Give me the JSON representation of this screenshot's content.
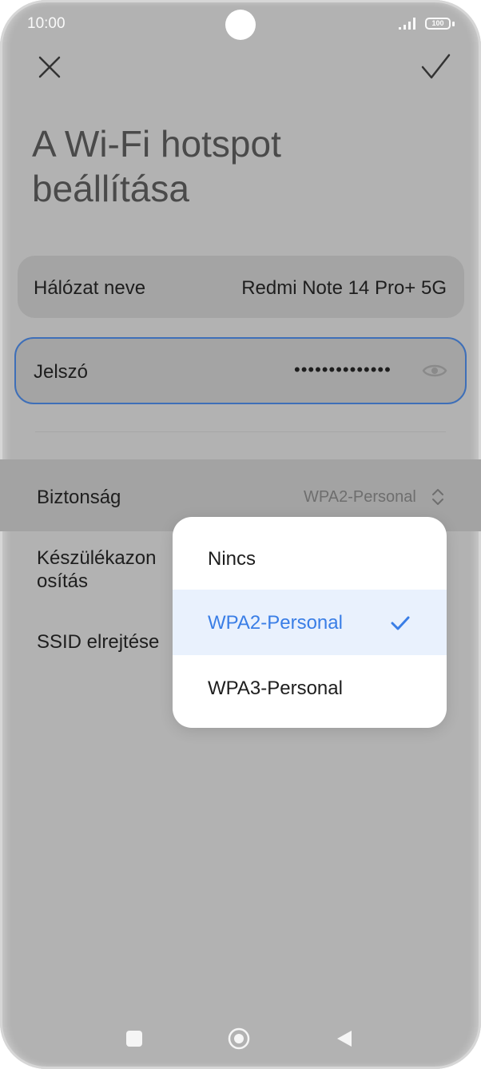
{
  "status_bar": {
    "time": "10:00",
    "battery": "100"
  },
  "header": {
    "title": "A Wi-Fi hotspot beállítása"
  },
  "network_name": {
    "label": "Hálózat neve",
    "value": "Redmi Note 14 Pro+ 5G"
  },
  "password": {
    "label": "Jelszó",
    "value": "••••••••••••••"
  },
  "security": {
    "label": "Biztonság",
    "value": "WPA2-Personal"
  },
  "device_connection": {
    "label": "Készülékazon\nosítás"
  },
  "ssid_hide": {
    "label": "SSID elrejtése"
  },
  "dropdown": {
    "options": [
      {
        "label": "Nincs"
      },
      {
        "label": "WPA2-Personal",
        "selected": true
      },
      {
        "label": "WPA3-Personal"
      }
    ]
  },
  "colors": {
    "accent": "#3a7ee6",
    "selected_bg": "#e9f1fd",
    "focus_border": "#3e6fb8"
  }
}
